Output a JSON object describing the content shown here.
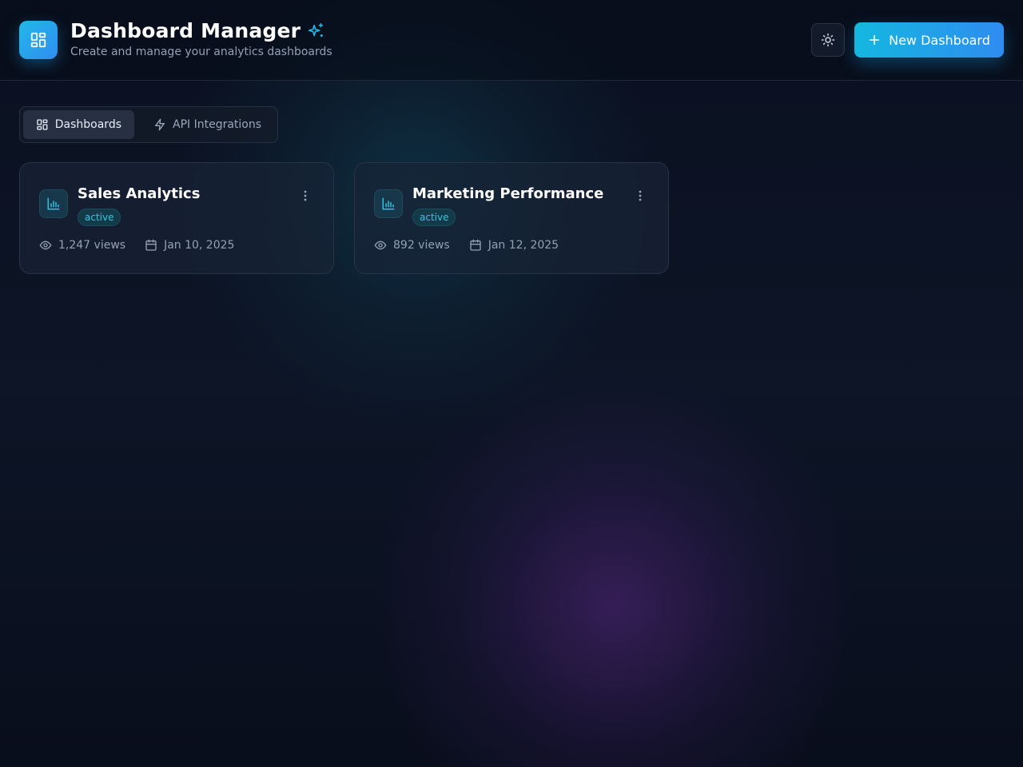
{
  "header": {
    "title": "Dashboard Manager",
    "subtitle": "Create and manage your analytics dashboards",
    "new_button_label": "New Dashboard"
  },
  "tabs": [
    {
      "label": "Dashboards",
      "icon": "grid-icon",
      "active": true
    },
    {
      "label": "API Integrations",
      "icon": "lightning-icon",
      "active": false
    }
  ],
  "dashboards": [
    {
      "title": "Sales Analytics",
      "status": "active",
      "views": "1,247 views",
      "date": "Jan 10, 2025"
    },
    {
      "title": "Marketing Performance",
      "status": "active",
      "views": "892 views",
      "date": "Jan 12, 2025"
    }
  ],
  "colors": {
    "accent": "#22b8e8",
    "accent_end": "#2f8cf0",
    "background": "#0b1120",
    "badge_text": "#3cc3e4"
  }
}
